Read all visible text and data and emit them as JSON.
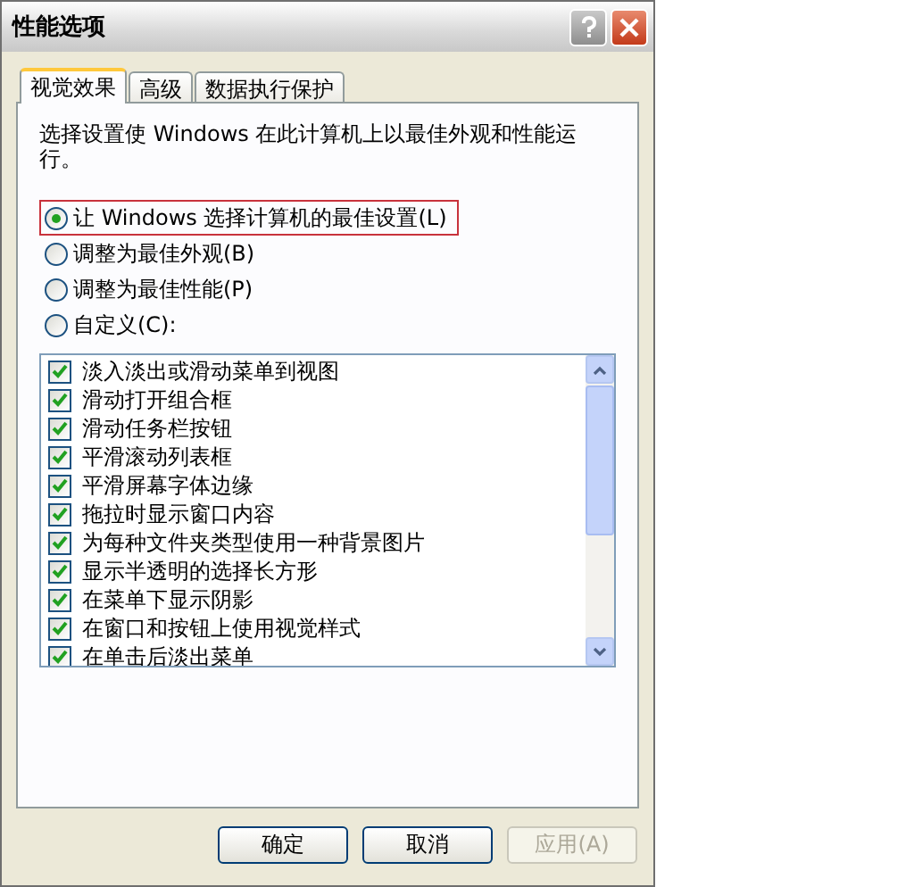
{
  "window": {
    "title": "性能选项"
  },
  "tabs": [
    {
      "label": "视觉效果",
      "selected": true
    },
    {
      "label": "高级",
      "selected": false
    },
    {
      "label": "数据执行保护",
      "selected": false
    }
  ],
  "description": "选择设置使 Windows 在此计算机上以最佳外观和性能运行。",
  "options": [
    {
      "label": "让 Windows 选择计算机的最佳设置(L)",
      "selected": true
    },
    {
      "label": "调整为最佳外观(B)",
      "selected": false
    },
    {
      "label": "调整为最佳性能(P)",
      "selected": false
    },
    {
      "label": "自定义(C):",
      "selected": false
    }
  ],
  "effects": [
    {
      "label": "淡入淡出或滑动菜单到视图",
      "checked": true
    },
    {
      "label": "滑动打开组合框",
      "checked": true
    },
    {
      "label": "滑动任务栏按钮",
      "checked": true
    },
    {
      "label": "平滑滚动列表框",
      "checked": true
    },
    {
      "label": "平滑屏幕字体边缘",
      "checked": true
    },
    {
      "label": "拖拉时显示窗口内容",
      "checked": true
    },
    {
      "label": "为每种文件夹类型使用一种背景图片",
      "checked": true
    },
    {
      "label": "显示半透明的选择长方形",
      "checked": true
    },
    {
      "label": "在菜单下显示阴影",
      "checked": true
    },
    {
      "label": "在窗口和按钮上使用视觉样式",
      "checked": true
    },
    {
      "label": "在单击后淡出菜单",
      "checked": true
    }
  ],
  "buttons": [
    {
      "label": "确定",
      "disabled": false
    },
    {
      "label": "取消",
      "disabled": false
    },
    {
      "label": "应用(A)",
      "disabled": true
    }
  ]
}
